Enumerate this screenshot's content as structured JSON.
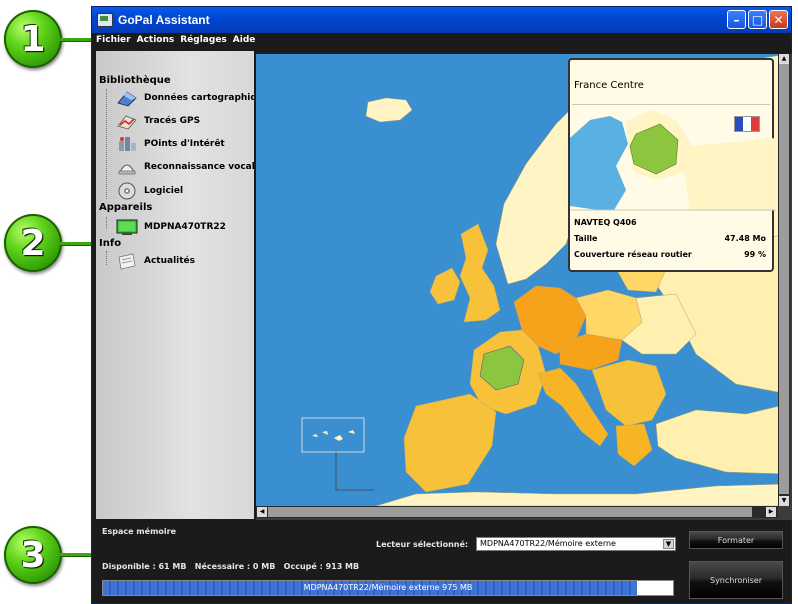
{
  "window": {
    "title": "GoPal Assistant",
    "title_bar_color": "#0046d0"
  },
  "callouts": [
    "1",
    "2",
    "3"
  ],
  "menu": [
    "Fichier",
    "Actions",
    "Réglages",
    "Aide"
  ],
  "sidebar": {
    "bibliotheque_label": "Bibliothèque",
    "bibliotheque_items": [
      {
        "label": "Données cartographiques",
        "icon": "map-data-icon"
      },
      {
        "label": "Tracés GPS",
        "icon": "gps-track-icon"
      },
      {
        "label": "POints d'Intérêt",
        "icon": "poi-icon"
      },
      {
        "label": "Reconnaissance vocale",
        "icon": "voice-icon"
      },
      {
        "label": "Logiciel",
        "icon": "software-cd-icon"
      }
    ],
    "appareils_label": "Appareils",
    "appareils_items": [
      {
        "label": "MDPNA470TR22",
        "icon": "device-icon"
      }
    ],
    "info_label": "Info",
    "info_items": [
      {
        "label": "Actualités",
        "icon": "news-icon"
      }
    ]
  },
  "map": {
    "sea_color": "#3a8fd0",
    "selected_color": "#8cc63f",
    "info_panel": {
      "region_title": "France Centre",
      "provider": "NAVTEQ Q406",
      "size_label": "Taille",
      "size_value": "47.48 Mo",
      "coverage_label": "Couverture réseau routier",
      "coverage_value": "99 %"
    }
  },
  "bottom": {
    "memory_label": "Espace mémoire",
    "drive_label": "Lecteur sélectionné:",
    "drive_value": "MDPNA470TR22/Mémoire externe",
    "stats": "Disponible : 61 MB   Nécessaire : 0 MB   Occupé : 913 MB",
    "progress_text": "MDPNA470TR22/Mémoire externe 975 MB",
    "progress_fraction": 0.936,
    "format_button": "Formater",
    "sync_button": "Synchroniser"
  }
}
